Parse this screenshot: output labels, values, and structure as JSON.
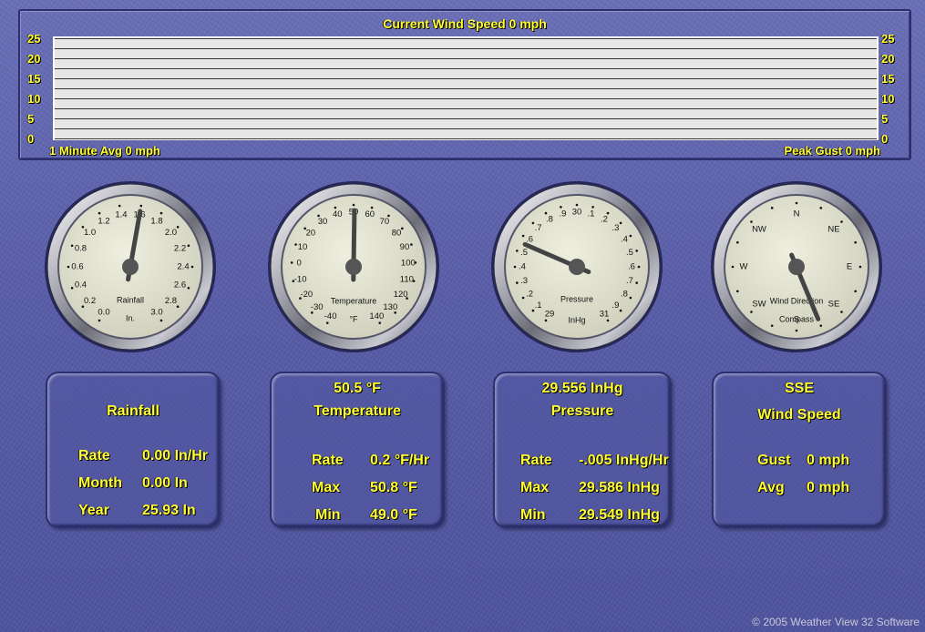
{
  "wind": {
    "title": "Current Wind Speed 0 mph",
    "avg_label": "1 Minute Avg 0 mph",
    "gust_label": "Peak Gust 0 mph",
    "y_ticks": [
      "25",
      "20",
      "15",
      "10",
      "5",
      "0"
    ]
  },
  "gauges": {
    "rain": {
      "caption": "Rainfall",
      "unit": "In.",
      "ticks": [
        "0.0",
        "0.2",
        "0.4",
        "0.6",
        "0.8",
        "1.0",
        "1.2",
        "1.4",
        "1.6",
        "1.8",
        "2.0",
        "2.2",
        "2.4",
        "2.6",
        "2.8",
        "3.0"
      ],
      "value": 1.6
    },
    "temp": {
      "caption": "Temperature",
      "unit": "°F",
      "ticks": [
        "-40",
        "-30",
        "-20",
        "-10",
        "0",
        "10",
        "20",
        "30",
        "40",
        "50",
        "60",
        "70",
        "80",
        "90",
        "100",
        "110",
        "120",
        "130",
        "140"
      ],
      "value": 50.5
    },
    "pressure": {
      "caption": "Pressure",
      "unit": "InHg",
      "ticks": [
        "29",
        ".1",
        ".2",
        ".3",
        ".4",
        ".5",
        ".6",
        ".7",
        ".8",
        ".9",
        "30",
        ".1",
        ".2",
        ".3",
        ".4",
        ".5",
        ".6",
        ".7",
        ".8",
        ".9",
        "31"
      ],
      "value": 29.556
    },
    "wind_dir": {
      "caption": "Wind Direction",
      "sub": "Compass",
      "points": [
        "N",
        "NE",
        "E",
        "SE",
        "S",
        "SW",
        "W",
        "NW"
      ],
      "direction": "SSE"
    }
  },
  "panels": {
    "rain": {
      "title": "Rainfall",
      "rows": [
        [
          "Rate",
          "0.00 In/Hr"
        ],
        [
          "Month",
          "0.00 In"
        ],
        [
          "Year",
          "25.93 In"
        ]
      ]
    },
    "temp": {
      "current": "50.5 °F",
      "title": "Temperature",
      "rows": [
        [
          "Rate",
          "0.2 °F/Hr"
        ],
        [
          "Max",
          "50.8 °F"
        ],
        [
          "Min",
          "49.0 °F"
        ]
      ]
    },
    "pressure": {
      "current": "29.556 InHg",
      "title": "Pressure",
      "rows": [
        [
          "Rate",
          "-.005 InHg/Hr"
        ],
        [
          "Max",
          "29.586 InHg"
        ],
        [
          "Min",
          "29.549 InHg"
        ]
      ]
    },
    "wind": {
      "current": "SSE",
      "title": "Wind Speed",
      "rows": [
        [
          "Gust",
          "0 mph"
        ],
        [
          "Avg",
          "0 mph"
        ]
      ]
    }
  },
  "footer": {
    "copyright": "© 2005 Weather View 32 Software"
  },
  "colors": {
    "label": "#ffff33",
    "background": "#5a5fa8",
    "dial_face": "#e2e2cf"
  }
}
